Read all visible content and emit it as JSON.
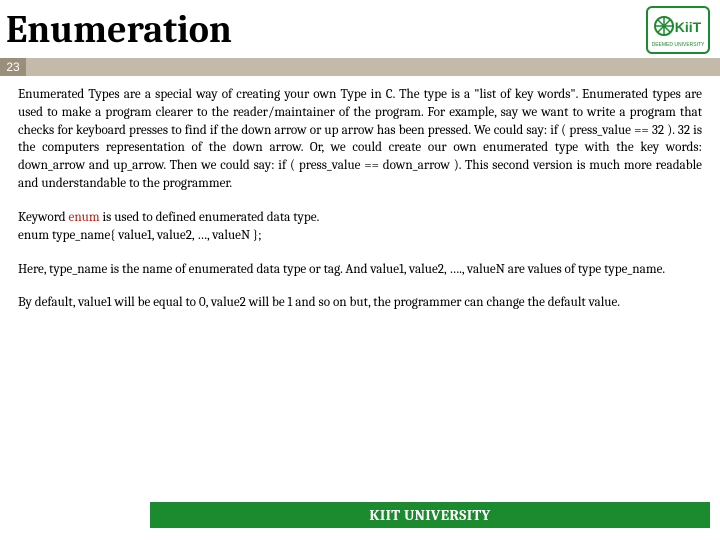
{
  "header": {
    "title": "Enumeration",
    "logo_alt": "KiiT"
  },
  "page_number": "23",
  "body": {
    "para1": "Enumerated Types are a special way of creating your own Type in C. The type is a \"list of key words\". Enumerated types are used to make a program clearer to the reader/maintainer of the program. For example, say we want to write a program that checks for keyboard presses to find if the down arrow or up arrow has been pressed. We could say: if ( press_value == 32 ). 32 is the computers representation of the down arrow. Or, we could create our own enumerated type with the key words: down_arrow and up_arrow. Then we could say: if ( press_value == down_arrow ). This second version is much more readable and understandable to the programmer.",
    "para2_pre": "Keyword ",
    "para2_kw": "enum",
    "para2_post": " is used to defined enumerated data type.",
    "para2_syntax": "enum type_name{ value1, value2, …, valueN };",
    "para3": "Here, type_name is the name of enumerated data type or tag. And value1, value2, …., valueN are values of type type_name.",
    "para4": "By default, value1 will be equal to 0, value2 will be 1 and so on but, the programmer can change the default value."
  },
  "footer": "KIIT UNIVERSITY"
}
